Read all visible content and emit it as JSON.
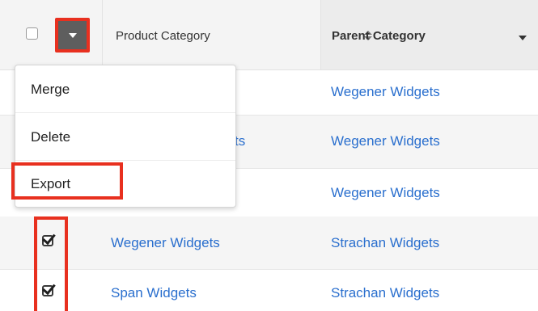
{
  "header": {
    "columns": {
      "product_category": "Product Category",
      "parent_category": "Parent Category"
    }
  },
  "rows": [
    {
      "product_category": "",
      "parent_category": "Wegener Widgets",
      "checked": false
    },
    {
      "product_category": "ts",
      "parent_category": "Wegener Widgets",
      "checked": false
    },
    {
      "product_category": "",
      "parent_category": "Wegener Widgets",
      "checked": false
    },
    {
      "product_category": "Wegener Widgets",
      "parent_category": "Strachan Widgets",
      "checked": true
    },
    {
      "product_category": "Span Widgets",
      "parent_category": "Strachan Widgets",
      "checked": true
    }
  ],
  "action_menu": {
    "items": [
      "Merge",
      "Delete",
      "Export"
    ]
  },
  "colors": {
    "link": "#2a6fce",
    "highlight": "#e8301f",
    "action_button": "#5e5e5e"
  },
  "icons": {
    "select_all": "checkbox-icon",
    "action_caret": "caret-down-icon",
    "sort": "sort-icon",
    "sorted_desc": "caret-down-icon"
  }
}
